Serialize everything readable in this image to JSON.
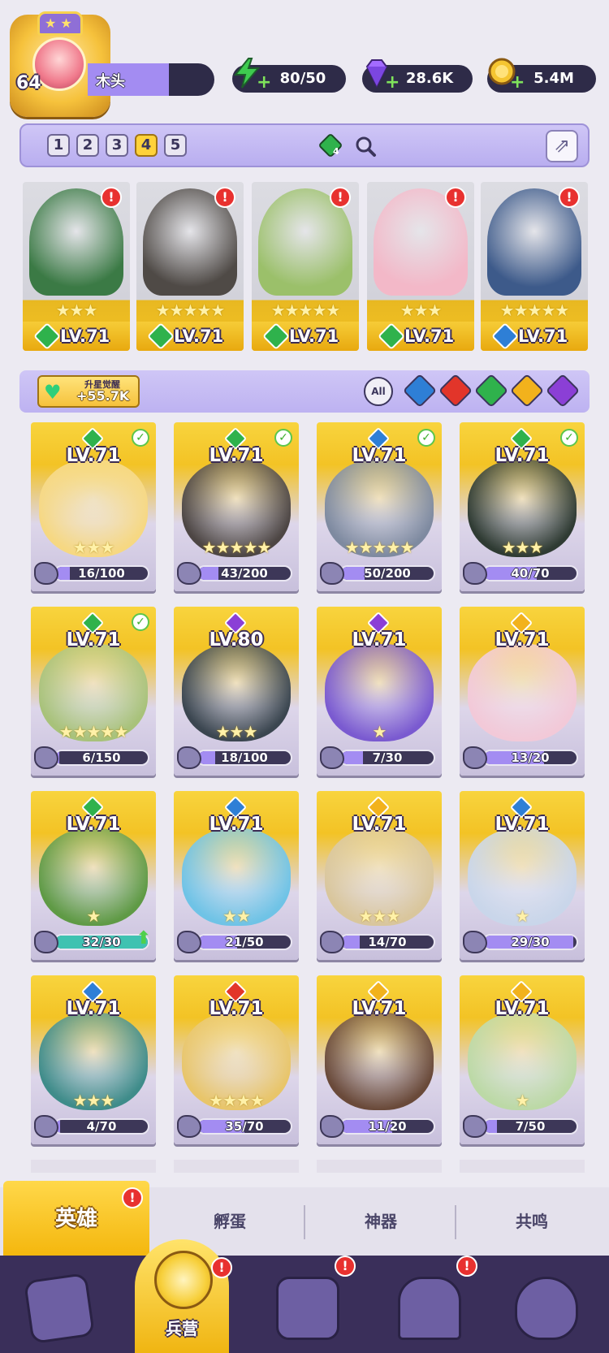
{
  "player": {
    "level": "64",
    "name": "木头"
  },
  "resources": [
    {
      "name": "energy",
      "icon": "lightning-icon",
      "value": "80/50",
      "color": "#3ecb4f"
    },
    {
      "name": "gems",
      "icon": "diamond-icon",
      "value": "28.6K",
      "color": "#a36bff"
    },
    {
      "name": "gold",
      "icon": "coin-icon",
      "value": "5.4M",
      "color": "#f5c531"
    }
  ],
  "team": {
    "tabs": [
      "1",
      "2",
      "3",
      "4",
      "5"
    ],
    "active_tab": "4",
    "power_badge": "4"
  },
  "team_heroes": [
    {
      "level": "LV.71",
      "stars": "★★★",
      "element": "wind",
      "color": "#3b7a45"
    },
    {
      "level": "LV.71",
      "stars": "★★★★★",
      "element": "wind",
      "color": "#4f4a46"
    },
    {
      "level": "LV.71",
      "stars": "★★★★★",
      "element": "wind",
      "color": "#9bc06a"
    },
    {
      "level": "LV.71",
      "stars": "★★★",
      "element": "wind",
      "color": "#f3b8c8"
    },
    {
      "level": "LV.71",
      "stars": "★★★★★",
      "element": "water",
      "color": "#3d5a8a"
    }
  ],
  "filter": {
    "awaken_title": "升星觉醒",
    "awaken_value": "+55.7K",
    "all_label": "All"
  },
  "element_colors": {
    "wind": "#2fb24c",
    "water": "#2e7fd6",
    "fire": "#e2352a",
    "light": "#f2b21c",
    "dark": "#8b3fd6"
  },
  "heroes": [
    {
      "level": "LV.71",
      "element": "wind",
      "stars": "★★★",
      "shards": "16/100",
      "progress": 0.16,
      "owned_check": true,
      "art": "#f6d882"
    },
    {
      "level": "LV.71",
      "element": "wind",
      "stars": "★★★★★",
      "shards": "43/200",
      "progress": 0.215,
      "owned_check": true,
      "art": "#4d4644"
    },
    {
      "level": "LV.71",
      "element": "water",
      "stars": "★★★★★",
      "shards": "50/200",
      "progress": 0.25,
      "owned_check": true,
      "art": "#7e8aa0"
    },
    {
      "level": "LV.71",
      "element": "wind",
      "stars": "★★★",
      "shards": "40/70",
      "progress": 0.571,
      "owned_check": true,
      "art": "#2f3b33"
    },
    {
      "level": "LV.71",
      "element": "wind",
      "stars": "★★★★★",
      "shards": "6/150",
      "progress": 0.04,
      "owned_check": true,
      "art": "#a8c27a"
    },
    {
      "level": "LV.80",
      "element": "dark",
      "stars": "★★★",
      "shards": "18/100",
      "progress": 0.18,
      "owned_check": false,
      "art": "#3b4650"
    },
    {
      "level": "LV.71",
      "element": "dark",
      "stars": "★",
      "shards": "7/30",
      "progress": 0.233,
      "owned_check": false,
      "art": "#7a5ad0"
    },
    {
      "level": "LV.71",
      "element": "light",
      "stars": "",
      "shards": "13/20",
      "progress": 0.65,
      "owned_check": false,
      "art": "#f2c9d8"
    },
    {
      "level": "LV.71",
      "element": "wind",
      "stars": "★",
      "shards": "32/30",
      "progress": 1.0,
      "owned_check": false,
      "upgradable": true,
      "art": "#5f9a45"
    },
    {
      "level": "LV.71",
      "element": "water",
      "stars": "★★",
      "shards": "21/50",
      "progress": 0.42,
      "owned_check": false,
      "art": "#6fc3e6"
    },
    {
      "level": "LV.71",
      "element": "light",
      "stars": "★★★",
      "shards": "14/70",
      "progress": 0.2,
      "owned_check": false,
      "art": "#d9c69c"
    },
    {
      "level": "LV.71",
      "element": "water",
      "stars": "★",
      "shards": "29/30",
      "progress": 0.967,
      "owned_check": false,
      "art": "#c9d6ea"
    },
    {
      "level": "LV.71",
      "element": "water",
      "stars": "★★★",
      "shards": "4/70",
      "progress": 0.057,
      "owned_check": false,
      "art": "#3f8c8a"
    },
    {
      "level": "LV.71",
      "element": "fire",
      "stars": "★★★★",
      "shards": "35/70",
      "progress": 0.5,
      "owned_check": false,
      "art": "#e8c56a"
    },
    {
      "level": "LV.71",
      "element": "light",
      "stars": "",
      "shards": "11/20",
      "progress": 0.55,
      "owned_check": false,
      "art": "#6a4a3a"
    },
    {
      "level": "LV.71",
      "element": "light",
      "stars": "★",
      "shards": "7/50",
      "progress": 0.14,
      "owned_check": false,
      "art": "#bcd9a6"
    }
  ],
  "subtabs": {
    "heroes": "英雄",
    "hatch": "孵蛋",
    "artifact": "神器",
    "resonance": "共鸣"
  },
  "bottom_nav": {
    "active_label": "兵营",
    "items": [
      {
        "icon": "cards-icon",
        "alert": false
      },
      {
        "icon": "barracks-icon",
        "alert": true
      },
      {
        "icon": "map-book-icon",
        "alert": true
      },
      {
        "icon": "temple-icon",
        "alert": true
      },
      {
        "icon": "mushroom-icon",
        "alert": false
      }
    ]
  }
}
